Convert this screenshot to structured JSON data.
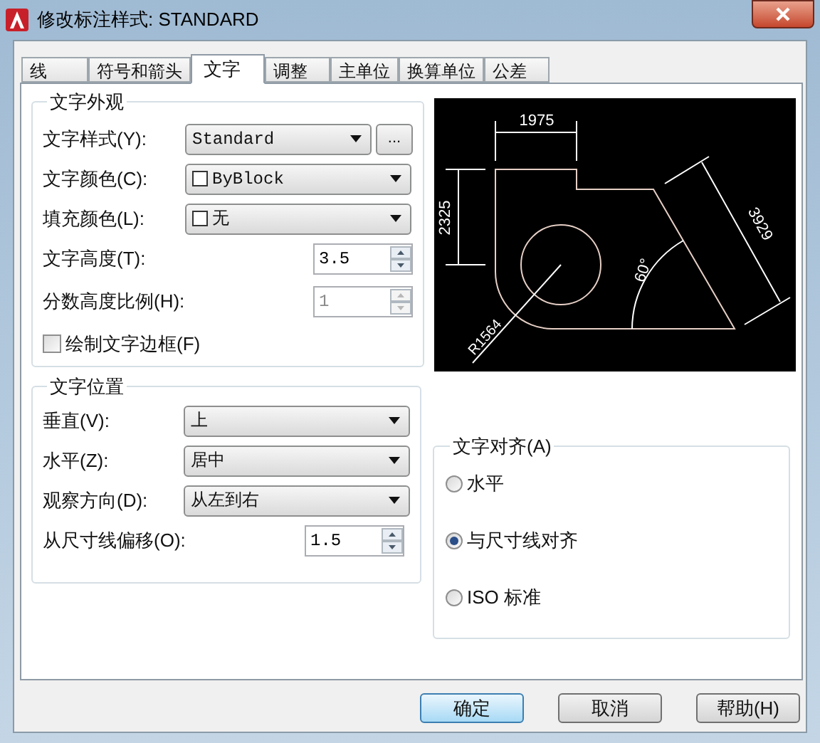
{
  "window": {
    "title": "修改标注样式: STANDARD"
  },
  "tabs": [
    {
      "label": "线",
      "selected": false
    },
    {
      "label": "符号和箭头",
      "selected": false
    },
    {
      "label": "文字",
      "selected": true
    },
    {
      "label": "调整",
      "selected": false
    },
    {
      "label": "主单位",
      "selected": false
    },
    {
      "label": "换算单位",
      "selected": false
    },
    {
      "label": "公差",
      "selected": false
    }
  ],
  "text_appearance": {
    "title": "文字外观",
    "rows": [
      {
        "kind": "combo",
        "label": "文字样式(Y):",
        "value": "Standard",
        "browse": "..."
      },
      {
        "kind": "combo",
        "label": "文字颜色(C):",
        "value": "ByBlock",
        "swatch": true
      },
      {
        "kind": "combo",
        "label": "填充颜色(L):",
        "value": "无",
        "swatch": true
      },
      {
        "kind": "spinner",
        "label": "文字高度(T):",
        "value": "3.5",
        "disabled": false
      },
      {
        "kind": "spinner",
        "label": "分数高度比例(H):",
        "value": "1",
        "disabled": true
      },
      {
        "kind": "checkbox",
        "label": "绘制文字边框(F)",
        "checked": false
      }
    ]
  },
  "text_placement": {
    "title": "文字位置",
    "rows": [
      {
        "kind": "combo",
        "label": "垂直(V):",
        "value": "上"
      },
      {
        "kind": "combo",
        "label": "水平(Z):",
        "value": "居中"
      },
      {
        "kind": "combo",
        "label": "观察方向(D):",
        "value": "从左到右"
      },
      {
        "kind": "spinner",
        "label": "从尺寸线偏移(O):",
        "value": "1.5",
        "disabled": false
      }
    ]
  },
  "preview": {
    "labels": [
      "1975",
      "2325",
      "3929",
      "R1564",
      "60°"
    ]
  },
  "text_alignment": {
    "title": "文字对齐(A)",
    "options": [
      {
        "label": "水平",
        "selected": false
      },
      {
        "label": "与尺寸线对齐",
        "selected": true
      },
      {
        "label": "ISO 标准",
        "selected": false
      }
    ]
  },
  "buttons": [
    {
      "label": "确定",
      "default": true
    },
    {
      "label": "取消",
      "default": false
    },
    {
      "label": "帮助(H)",
      "default": false
    }
  ]
}
